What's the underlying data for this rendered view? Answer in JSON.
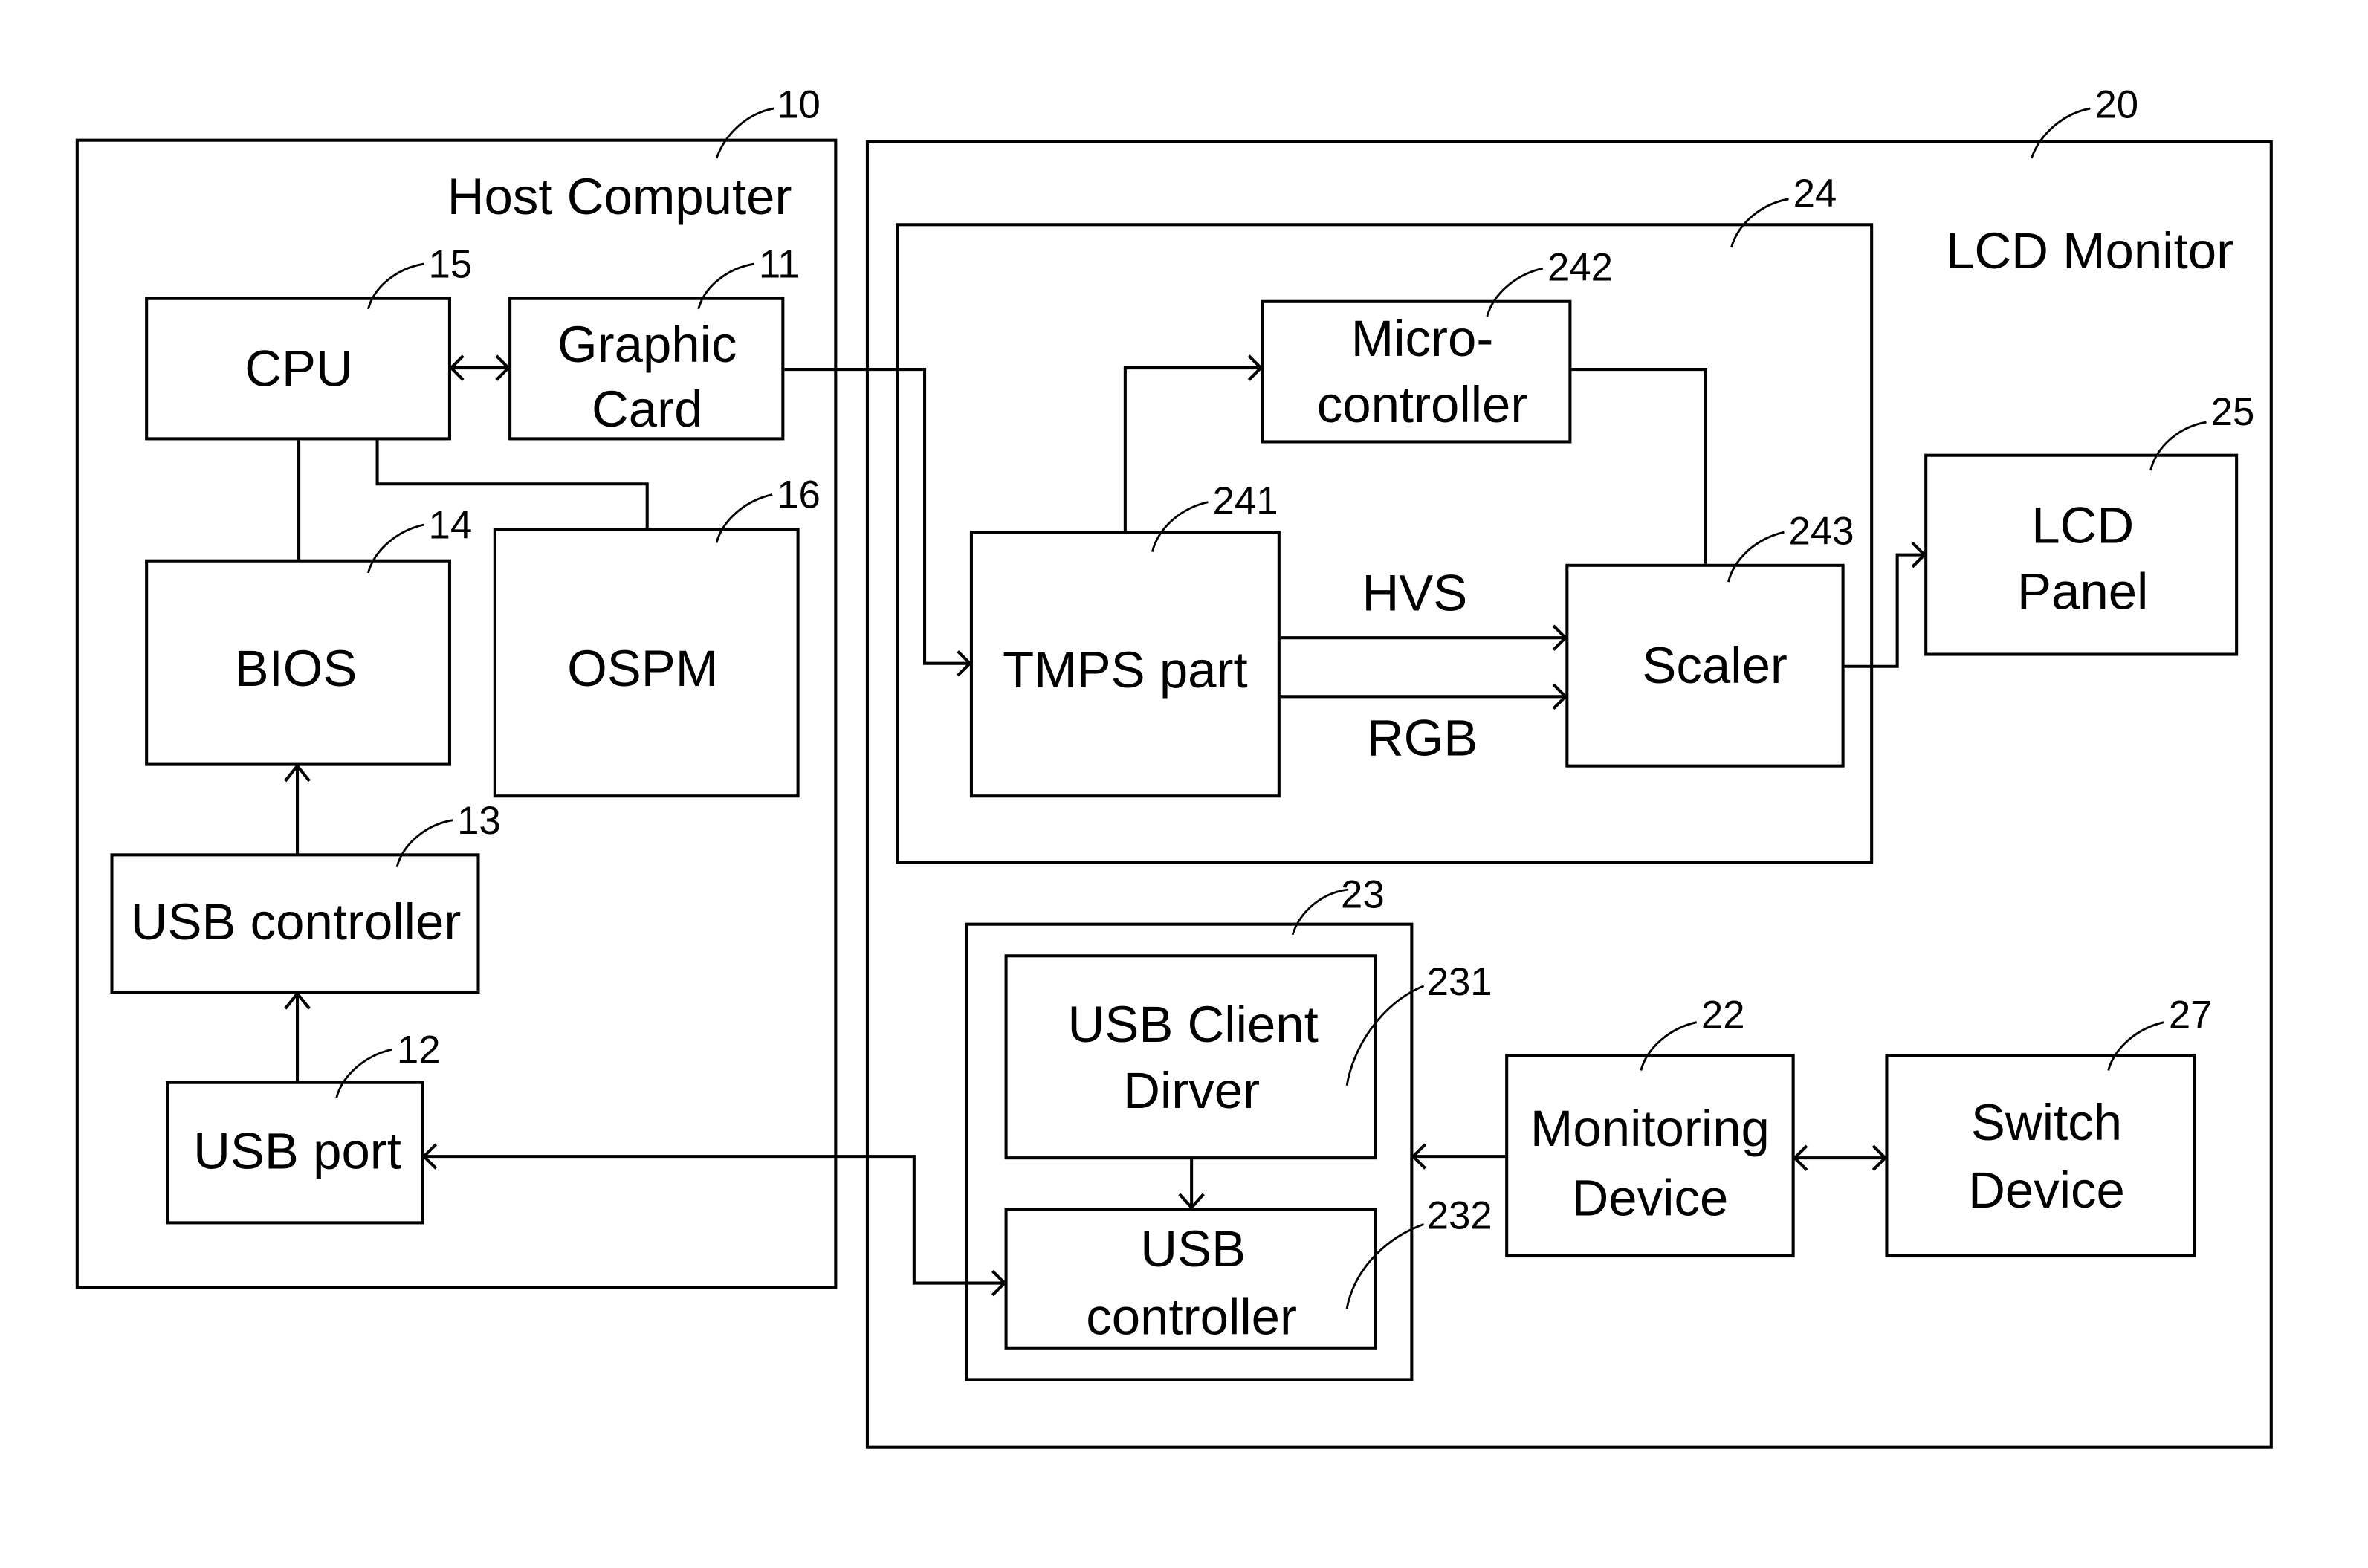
{
  "diagram": {
    "host": {
      "title": "Host Computer",
      "ref": "10",
      "blocks": {
        "cpu": {
          "label": [
            "CPU"
          ],
          "ref": "15"
        },
        "graphic_card": {
          "label": [
            "Graphic",
            "Card"
          ],
          "ref": "11"
        },
        "bios": {
          "label": [
            "BIOS"
          ],
          "ref": "14"
        },
        "ospm": {
          "label": [
            "OSPM"
          ],
          "ref": "16"
        },
        "usb_controller": {
          "label": [
            "USB controller"
          ],
          "ref": "13"
        },
        "usb_port": {
          "label": [
            "USB port"
          ],
          "ref": "12"
        }
      }
    },
    "monitor": {
      "title": "LCD Monitor",
      "ref": "20",
      "control_unit": {
        "ref": "24",
        "blocks": {
          "microcontroller": {
            "label": [
              "Micro-",
              "controller"
            ],
            "ref": "242"
          },
          "tmps": {
            "label": [
              "TMPS part"
            ],
            "ref": "241"
          },
          "scaler": {
            "label": [
              "Scaler"
            ],
            "ref": "243"
          }
        },
        "signals": {
          "hvs": "HVS",
          "rgb": "RGB"
        }
      },
      "lcd_panel": {
        "label": [
          "LCD",
          "Panel"
        ],
        "ref": "25"
      },
      "usb_unit": {
        "ref": "23",
        "blocks": {
          "client_driver": {
            "label": [
              "USB Client",
              "Dirver"
            ],
            "ref": "231"
          },
          "usb_controller": {
            "label": [
              "USB",
              "controller"
            ],
            "ref": "232"
          }
        }
      },
      "monitoring_device": {
        "label": [
          "Monitoring",
          "Device"
        ],
        "ref": "22"
      },
      "switch_device": {
        "label": [
          "Switch",
          "Device"
        ],
        "ref": "27"
      }
    }
  }
}
